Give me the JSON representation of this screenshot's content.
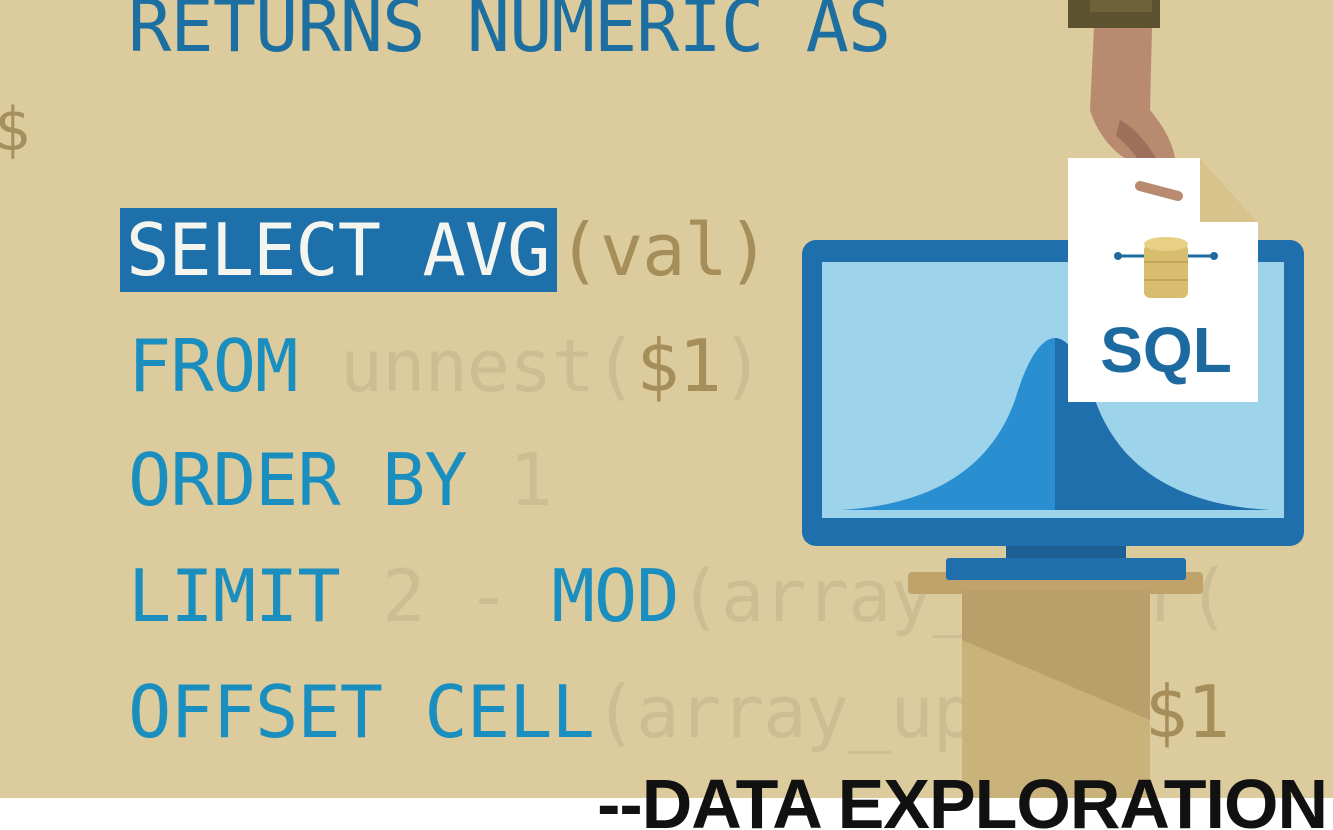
{
  "code": {
    "top_line": {
      "kw": "RETURNS NUMERIC AS"
    },
    "side_symbol": "$",
    "line1": {
      "selected": "SELECT AVG",
      "rest": "(val)"
    },
    "line2": {
      "kw": "FROM",
      "fn": "unnest(",
      "arg": "$1",
      "close": ")"
    },
    "line3": {
      "kw": "ORDER BY",
      "rest": "1"
    },
    "line4": {
      "kw": "LIMIT",
      "mid": "2 - ",
      "kw2": "MOD",
      "rest": "(array_upper("
    },
    "line5": {
      "kw": "OFFSET CELL",
      "rest": "(array_upper(",
      "arg": "$1"
    }
  },
  "document_label": "SQL",
  "caption": "--DATA EXPLORATION",
  "colors": {
    "background": "#dccb9c",
    "keyword": "#1a8fbf",
    "selection": "#1d70aa",
    "monitor_frame": "#1f6fac",
    "screen": "#9ed3ec",
    "curve": "#2a8fd0",
    "stand": "#c9b37a",
    "caption": "#111111"
  },
  "icons": [
    "hand-icon",
    "sql-document-icon",
    "database-icon",
    "monitor-icon",
    "bell-curve-icon",
    "pedestal-icon"
  ]
}
